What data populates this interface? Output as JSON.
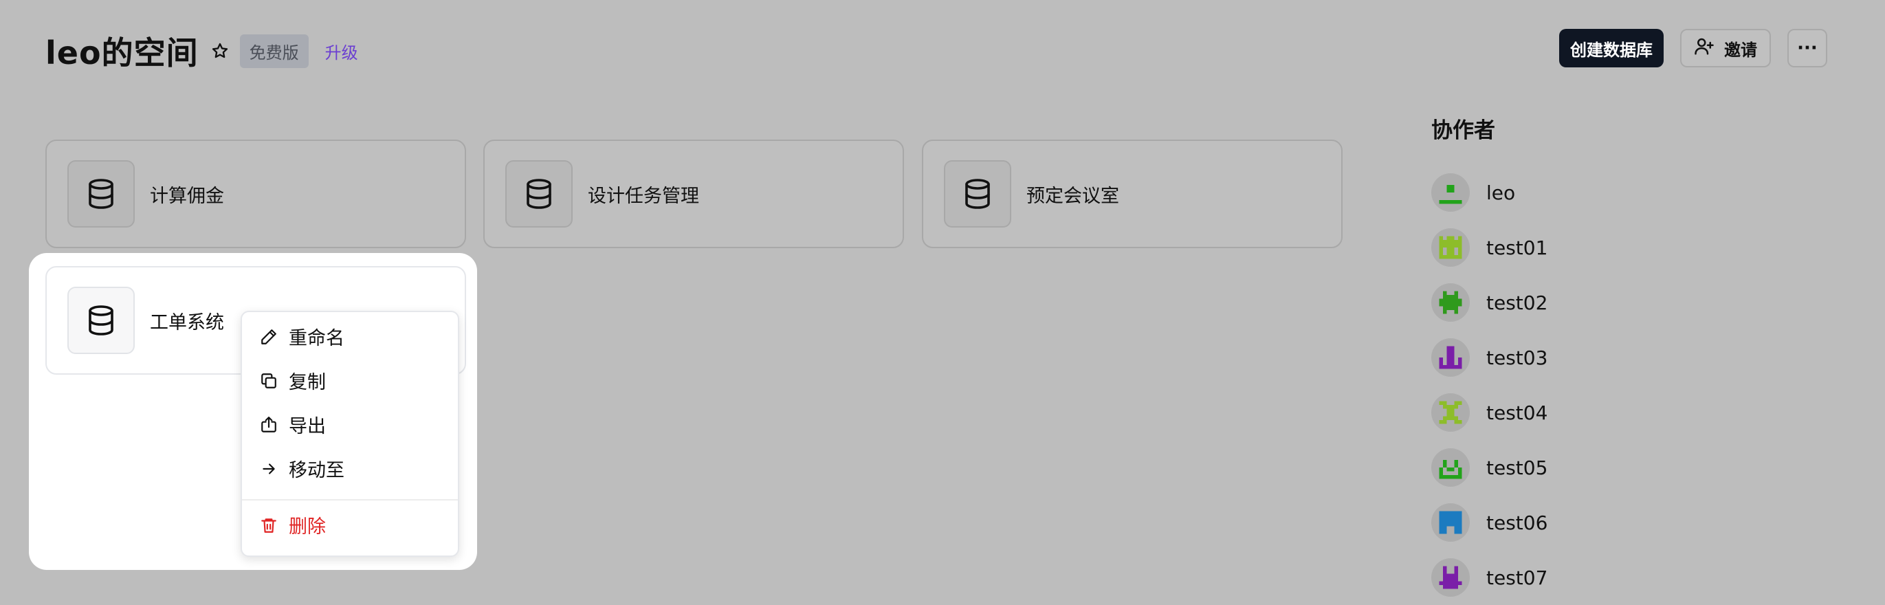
{
  "header": {
    "title": "leo的空间",
    "plan_badge": "免费版",
    "upgrade": "升级"
  },
  "actions": {
    "create_db": "创建数据库",
    "invite": "邀请",
    "more": "···"
  },
  "databases": [
    {
      "name": "计算佣金"
    },
    {
      "name": "设计任务管理"
    },
    {
      "name": "预定会议室"
    },
    {
      "name": "工单系统"
    }
  ],
  "context_menu": {
    "rename": "重命名",
    "copy": "复制",
    "export": "导出",
    "move_to": "移动至",
    "delete": "删除"
  },
  "collaborators": {
    "title": "协作者",
    "people": [
      {
        "name": "leo",
        "color": "#22a31a"
      },
      {
        "name": "test01",
        "color": "#8dbd2a"
      },
      {
        "name": "test02",
        "color": "#2f9a1c"
      },
      {
        "name": "test03",
        "color": "#7a1ea8"
      },
      {
        "name": "test04",
        "color": "#8dbd2a"
      },
      {
        "name": "test05",
        "color": "#22a31a"
      },
      {
        "name": "test06",
        "color": "#1c7bc0"
      },
      {
        "name": "test07",
        "color": "#7a1ea8"
      }
    ]
  },
  "colors": {
    "primary_button": "#0f1623",
    "upgrade_link": "#6b3fd1",
    "danger": "#e02424"
  }
}
